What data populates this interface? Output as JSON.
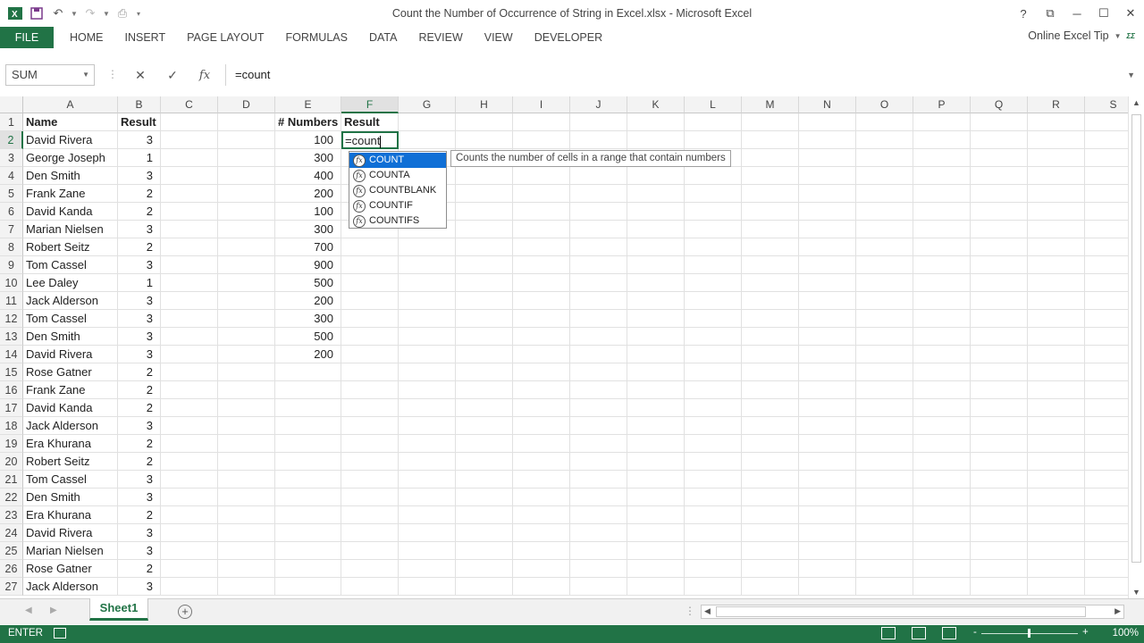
{
  "window": {
    "title": "Count the Number of Occurrence of String in Excel.xlsx - Microsoft Excel",
    "help": "?",
    "app_icon": "excel-logo"
  },
  "ribbon": {
    "tabs": [
      "FILE",
      "HOME",
      "INSERT",
      "PAGE LAYOUT",
      "FORMULAS",
      "DATA",
      "REVIEW",
      "VIEW",
      "DEVELOPER"
    ],
    "account": "Online Excel Tip"
  },
  "formula_bar": {
    "name_box": "SUM",
    "formula": "=count",
    "fx_label": "fx"
  },
  "grid": {
    "columns": [
      "A",
      "B",
      "C",
      "D",
      "E",
      "F",
      "G",
      "H",
      "I",
      "J",
      "K",
      "L",
      "M",
      "N",
      "O",
      "P",
      "Q",
      "R",
      "S"
    ],
    "active_column": "F",
    "active_row": "2",
    "rows": [
      "1",
      "2",
      "3",
      "4",
      "5",
      "6",
      "7",
      "8",
      "9",
      "10",
      "11",
      "12",
      "13",
      "14",
      "15",
      "16",
      "17",
      "18",
      "19",
      "20",
      "21",
      "22",
      "23",
      "24",
      "25",
      "26",
      "27"
    ],
    "header_a": "Name",
    "header_b": "Result",
    "header_e": "# Numbers",
    "header_f": "Result",
    "names": [
      "David Rivera",
      "George Joseph",
      "Den Smith",
      "Frank Zane",
      "David Kanda",
      "Marian Nielsen",
      "Robert Seitz",
      "Tom Cassel",
      "Lee Daley",
      "Jack Alderson",
      "Tom Cassel",
      "Den Smith",
      "David Rivera",
      "Rose Gatner",
      "Frank Zane",
      "David Kanda",
      "Jack Alderson",
      "Era Khurana",
      "Robert Seitz",
      "Tom Cassel",
      "Den Smith",
      "Era Khurana",
      "David Rivera",
      "Marian Nielsen",
      "Rose Gatner",
      "Jack Alderson"
    ],
    "results": [
      "3",
      "1",
      "3",
      "2",
      "2",
      "3",
      "2",
      "3",
      "1",
      "3",
      "3",
      "3",
      "3",
      "2",
      "2",
      "2",
      "3",
      "2",
      "2",
      "3",
      "3",
      "2",
      "3",
      "3",
      "2",
      "3"
    ],
    "numbers": [
      "100",
      "300",
      "400",
      "200",
      "100",
      "300",
      "700",
      "900",
      "500",
      "200",
      "300",
      "500",
      "200"
    ],
    "editing_cell_text": "=count"
  },
  "autocomplete": {
    "items": [
      "COUNT",
      "COUNTA",
      "COUNTBLANK",
      "COUNTIF",
      "COUNTIFS"
    ],
    "selected": "COUNT",
    "tooltip": "Counts the number of cells in a range that contain numbers"
  },
  "sheets": {
    "tabs": [
      "Sheet1"
    ],
    "add_label": "+"
  },
  "status": {
    "mode": "ENTER",
    "zoom": "100%",
    "zoom_minus": "-",
    "zoom_plus": "+"
  }
}
